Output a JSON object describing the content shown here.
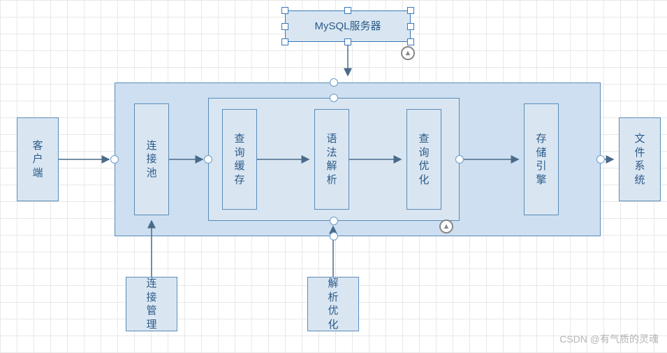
{
  "title_box": {
    "label": "MySQL服务器"
  },
  "client_box": {
    "label": "客户端"
  },
  "file_box": {
    "label": "文件系统"
  },
  "conn_pool_box": {
    "label": "连接池"
  },
  "query_cache_box": {
    "label": "查询缓存"
  },
  "syntax_parse_box": {
    "label": "语法解析"
  },
  "query_opt_box": {
    "label": "查询优化"
  },
  "storage_engine_box": {
    "label": "存储引擎"
  },
  "conn_mgmt_box": {
    "label": "连接管理"
  },
  "parse_opt_box": {
    "label": "解析优化"
  },
  "watermark": "CSDN @有气质的灵魂",
  "colors": {
    "box_fill": "#d9e6f2",
    "box_border": "#5a8bb8",
    "container_fill": "#cddff0",
    "text": "#2c5a88",
    "arrow": "#4a6a8a"
  }
}
